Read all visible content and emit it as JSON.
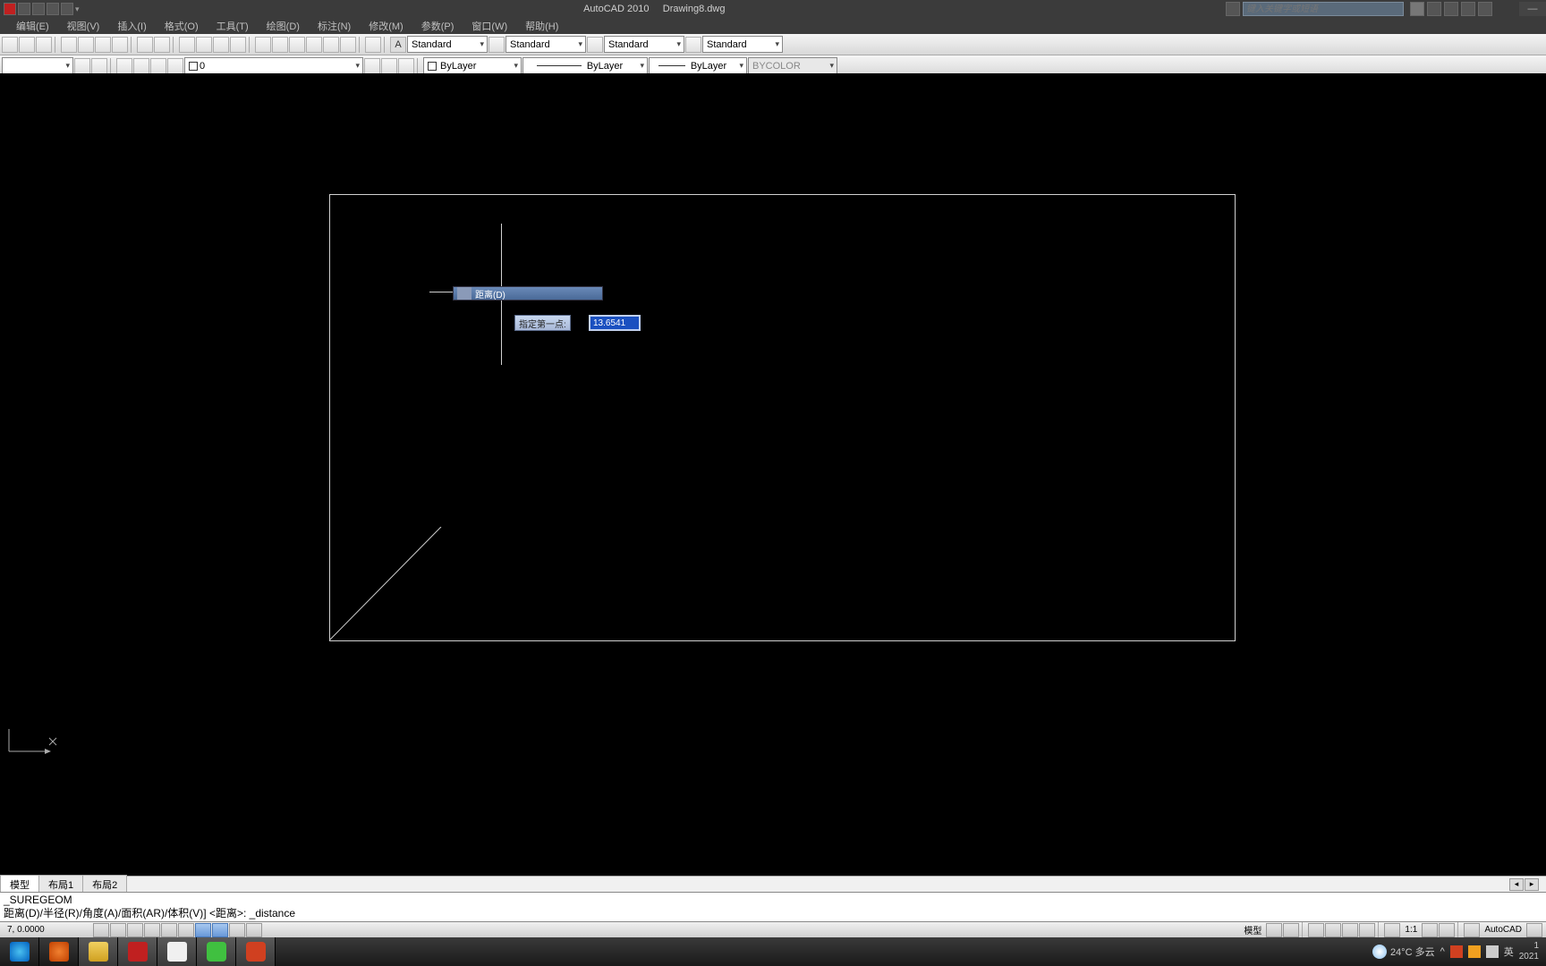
{
  "title": {
    "app": "AutoCAD 2010",
    "doc": "Drawing8.dwg"
  },
  "search": {
    "placeholder": "键入关键字或短语"
  },
  "menu": [
    "编辑(E)",
    "视图(V)",
    "插入(I)",
    "格式(O)",
    "工具(T)",
    "绘图(D)",
    "标注(N)",
    "修改(M)",
    "参数(P)",
    "窗口(W)",
    "帮助(H)"
  ],
  "toolbar2": {
    "style1": "Standard",
    "style2": "Standard",
    "style3": "Standard",
    "style4": "Standard",
    "layer_dd": "0",
    "bylayer1": "ByLayer",
    "bylayer2": "ByLayer",
    "bylayer3": "ByLayer",
    "bycolor": "BYCOLOR"
  },
  "floating": {
    "menu_text": "距离(D)",
    "prompt": "指定第一点:",
    "input_value": "13.6541"
  },
  "tabs": {
    "model": "模型",
    "layout1": "布局1",
    "layout2": "布局2"
  },
  "command": {
    "line1": "_SUREGEOM",
    "line2": "距离(D)/半径(R)/角度(A)/面积(AR)/体积(V)] <距离>: _distance"
  },
  "status": {
    "coords": "7, 0.0000",
    "model_label": "模型",
    "scale": "1:1",
    "autocad": "AutoCAD"
  },
  "tray": {
    "weather": "24°C 多云",
    "ime": "英",
    "time": "1",
    "date": "2021"
  }
}
